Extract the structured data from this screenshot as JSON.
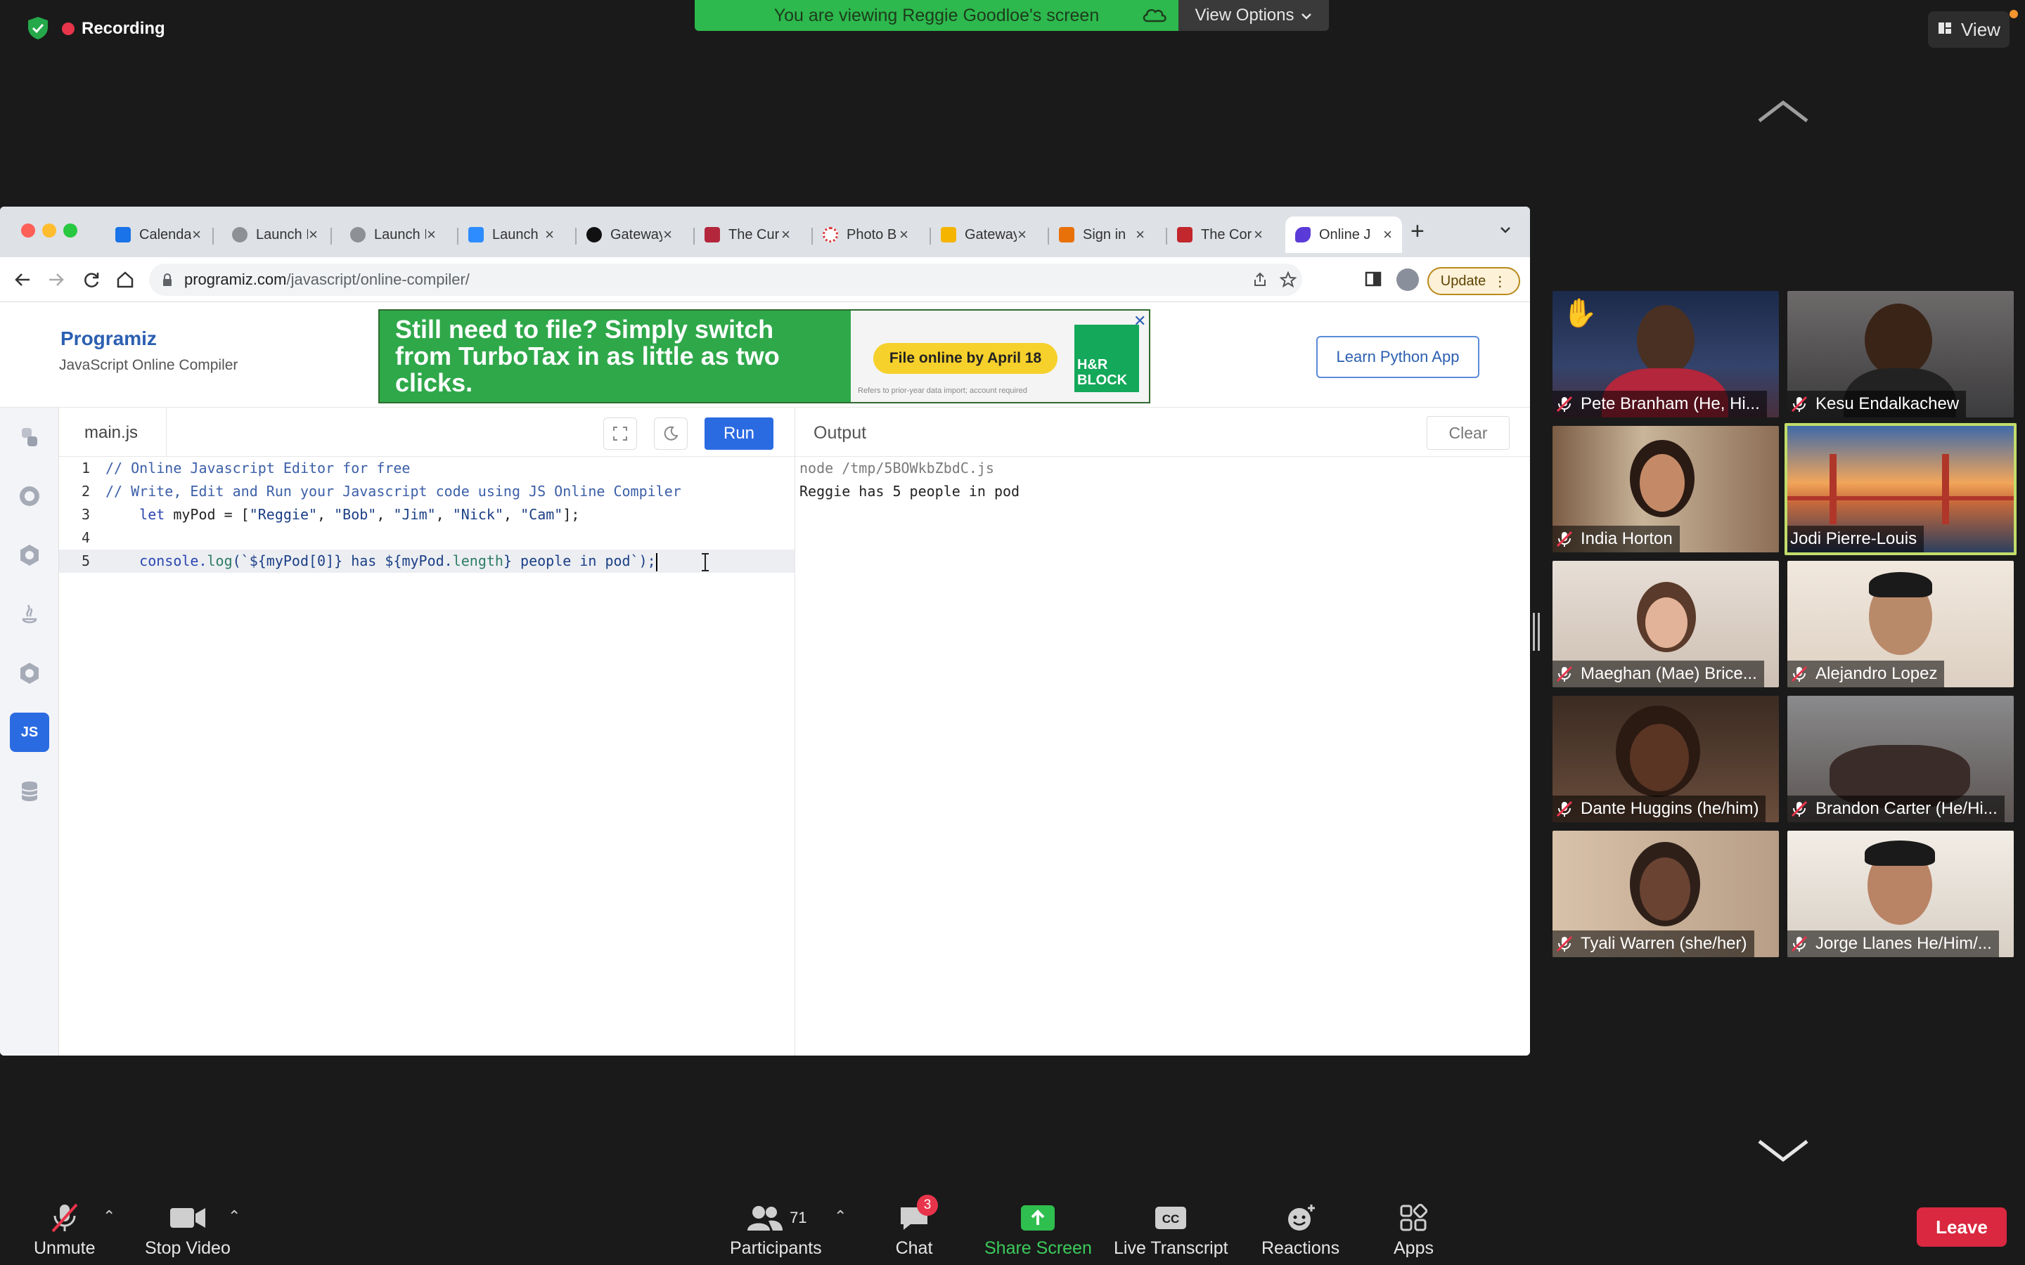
{
  "zoom": {
    "recording_label": "Recording",
    "viewing_banner": "You are viewing Reggie Goodloe's screen",
    "view_options_label": "View Options",
    "view_label": "View"
  },
  "browser": {
    "tabs": [
      {
        "label": "Calenda",
        "icon_color": "#1a73e8"
      },
      {
        "label": "Launch I",
        "icon_color": "#5f6368"
      },
      {
        "label": "Launch I",
        "icon_color": "#5f6368"
      },
      {
        "label": "Launch",
        "icon_color": "#2d8cff"
      },
      {
        "label": "Gateway",
        "icon_color": "#111111"
      },
      {
        "label": "The Cur",
        "icon_color": "#b3263c"
      },
      {
        "label": "Photo B",
        "icon_color": "#d93a3a"
      },
      {
        "label": "Gateway",
        "icon_color": "#f4b400"
      },
      {
        "label": "Sign in",
        "icon_color": "#e8710a"
      },
      {
        "label": "The Cor",
        "icon_color": "#c1272d"
      },
      {
        "label": "Online J",
        "icon_color": "#5b3bd8"
      }
    ],
    "url_domain": "programiz.com",
    "url_path": "/javascript/online-compiler/",
    "update_label": "Update"
  },
  "page": {
    "logo": "Programiz",
    "logo_sub": "JavaScript Online Compiler",
    "ad_headline": "Still need to file? Simply switch from TurboTax in as little as two clicks.",
    "ad_cta": "File online by April 18",
    "ad_brand": "H&R BLOCK",
    "ad_fine": "Refers to prior-year data import; account required",
    "learn_button": "Learn Python App"
  },
  "compiler": {
    "file_tab": "main.js",
    "run_label": "Run",
    "output_label": "Output",
    "clear_label": "Clear",
    "active_language": "JS",
    "code": [
      {
        "n": "1",
        "text": "// Online Javascript Editor for free"
      },
      {
        "n": "2",
        "text": "// Write, Edit and Run your Javascript code using JS Online Compiler"
      },
      {
        "n": "3",
        "kw": "let",
        "rest": " myPod = [",
        "s1": "\"Reggie\"",
        "s2": "\"Bob\"",
        "s3": "\"Jim\"",
        "s4": "\"Nick\"",
        "s5": "\"Cam\"",
        "end": "];"
      },
      {
        "n": "4",
        "text": ""
      },
      {
        "n": "5",
        "a": "console.",
        "b": "log",
        "c": "(`${myPod[0]} has ${myPod.",
        "d": "length",
        "e": "} people in pod`);"
      }
    ],
    "output": [
      "node /tmp/5BOWkbZbdC.js",
      "Reggie has 5 people in pod"
    ]
  },
  "participants": [
    {
      "name": "Pete Branham (He, Hi...",
      "raised_hand": true
    },
    {
      "name": "Kesu Endalkachew"
    },
    {
      "name": "India Horton"
    },
    {
      "name": "Jodi Pierre-Louis",
      "speaking": true
    },
    {
      "name": "Maeghan (Mae) Brice..."
    },
    {
      "name": "Alejandro Lopez"
    },
    {
      "name": "Dante Huggins (he/him)"
    },
    {
      "name": "Brandon Carter (He/Hi..."
    },
    {
      "name": "Tyali Warren (she/her)"
    },
    {
      "name": "Jorge Llanes He/Him/..."
    }
  ],
  "controls": {
    "unmute": "Unmute",
    "stop_video": "Stop Video",
    "participants": "Participants",
    "participants_count": "71",
    "chat": "Chat",
    "chat_badge": "3",
    "share_screen": "Share Screen",
    "live_transcript": "Live Transcript",
    "reactions": "Reactions",
    "apps": "Apps",
    "leave": "Leave"
  }
}
